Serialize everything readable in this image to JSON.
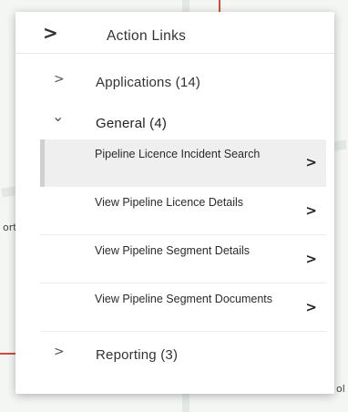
{
  "panel": {
    "title": "Action Links",
    "collapse_icon": ">"
  },
  "groups": [
    {
      "label": "Applications (14)",
      "chevron": ">",
      "expanded": false
    },
    {
      "label": "General (4)",
      "chevron": "⌄",
      "expanded": true
    },
    {
      "label": "Reporting (3)",
      "chevron": ">",
      "expanded": false
    }
  ],
  "general_items": [
    {
      "label": "Pipeline Licence Incident Search",
      "arrow": ">",
      "selected": true
    },
    {
      "label": "View Pipeline Licence Details",
      "arrow": ">",
      "selected": false
    },
    {
      "label": "View Pipeline Segment Details",
      "arrow": ">",
      "selected": false
    },
    {
      "label": "View Pipeline Segment Documents",
      "arrow": ">",
      "selected": false
    }
  ],
  "map_fragments": {
    "left_text": "ort",
    "right_text": "ol"
  },
  "colors": {
    "panel_bg": "#ffffff",
    "selected_bg": "#efefef",
    "map_red": "#d24b3c"
  }
}
